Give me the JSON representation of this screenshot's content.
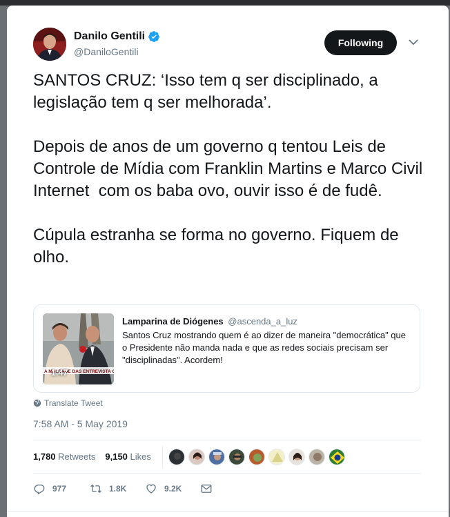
{
  "author": {
    "display_name": "Danilo Gentili",
    "handle": "@DaniloGentili",
    "verified": true
  },
  "follow_button": {
    "label": "Following"
  },
  "tweet": {
    "text": "SANTOS CRUZ: ‘Isso tem q ser disciplinado, a legislação tem q ser melhorada’.\n\nDepois de anos de um governo q tentou Leis de Controle de Mídia com Franklin Martins e Marco Civil Internet  com os baba ovo, ouvir isso é de fudê.\n\nCúpula estranha se forma no governo. Fiquem de olho."
  },
  "quote": {
    "author_name": "Lamparina de Diógenes",
    "author_handle": "@ascenda_a_luz",
    "text": "Santos Cruz mostrando quem é ao dizer de maneira \"democrática\" que o Presidente não manda nada e que as redes sociais precisam ser \"disciplinadas\". Acordem!",
    "video_duration": "1:47",
    "video_caption": "A MALDADE DAS ENTREVISTA GEN. SANT"
  },
  "translate_label": "Translate Tweet",
  "timestamp": "7:58 AM - 5 May 2019",
  "stats": {
    "retweets_count": "1,780",
    "retweets_label": "Retweets",
    "likes_count": "9,150",
    "likes_label": "Likes"
  },
  "actions": {
    "replies": "977",
    "retweets": "1.8K",
    "likes": "9.2K"
  },
  "colors": {
    "text": "#14171a",
    "secondary": "#657786",
    "verified": "#1da1f2",
    "button_bg": "#14171a"
  }
}
